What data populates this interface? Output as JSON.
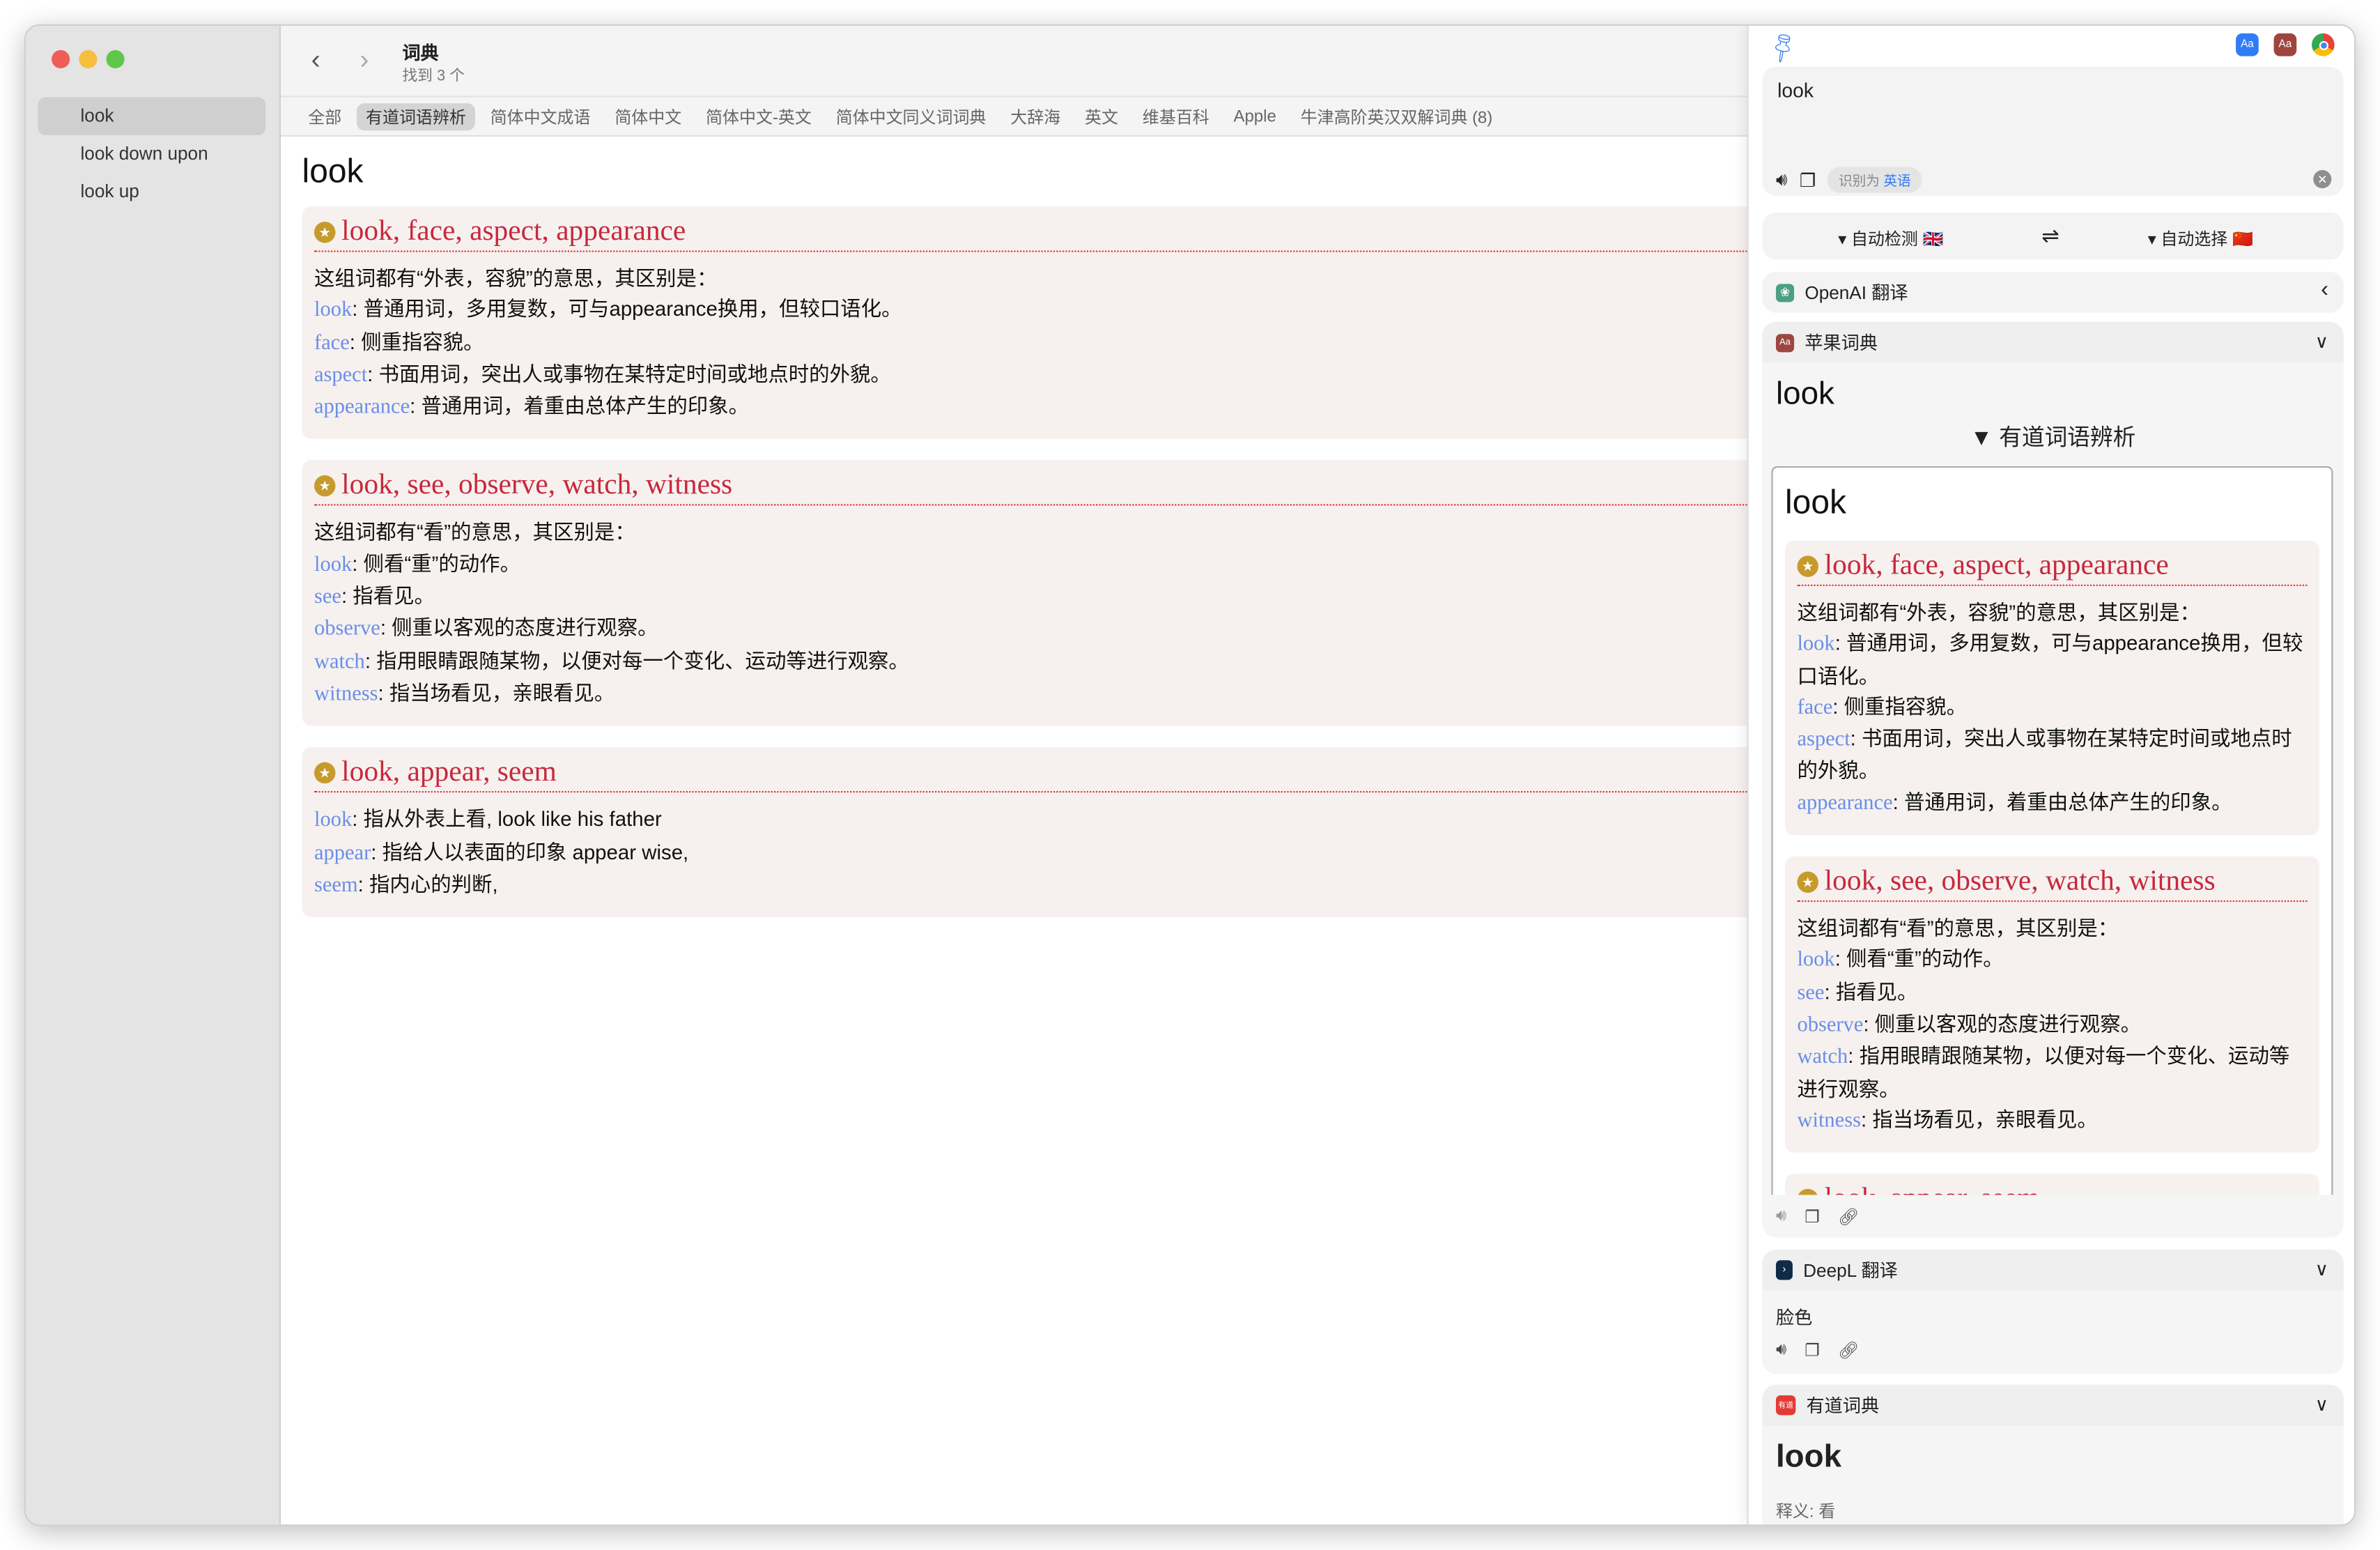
{
  "sidebar": {
    "items": [
      {
        "label": "look",
        "selected": true
      },
      {
        "label": "look down upon"
      },
      {
        "label": "look up"
      }
    ]
  },
  "toolbar": {
    "back_icon": "chevron-left-icon",
    "forward_icon": "chevron-right-icon",
    "title": "词典",
    "subtitle": "找到 3 个"
  },
  "tabs": [
    {
      "label": "全部"
    },
    {
      "label": "有道词语辨析",
      "selected": true
    },
    {
      "label": "简体中文成语"
    },
    {
      "label": "简体中文"
    },
    {
      "label": "简体中文-英文"
    },
    {
      "label": "简体中文同义词词典"
    },
    {
      "label": "大辞海"
    },
    {
      "label": "英文"
    },
    {
      "label": "维基百科"
    },
    {
      "label": "Apple"
    },
    {
      "label": "牛津高阶英汉双解词典 (8)"
    }
  ],
  "main": {
    "headword": "look",
    "entries": [
      {
        "title": "look, face, aspect, appearance",
        "intro": "这组词都有“外表，容貌”的意思，其区别是：",
        "lines": [
          {
            "word": "look",
            "def": ": 普通用词，多用复数，可与appearance换用，但较口语化。"
          },
          {
            "word": "face",
            "def": ": 侧重指容貌。"
          },
          {
            "word": "aspect",
            "def": ": 书面用词，突出人或事物在某特定时间或地点时的外貌。"
          },
          {
            "word": "appearance",
            "def": ": 普通用词，着重由总体产生的印象。"
          }
        ]
      },
      {
        "title": "look, see, observe, watch, witness",
        "intro": "这组词都有“看”的意思，其区别是：",
        "lines": [
          {
            "word": "look",
            "def": ": 侧看“重”的动作。"
          },
          {
            "word": "see",
            "def": ": 指看见。"
          },
          {
            "word": "observe",
            "def": ": 侧重以客观的态度进行观察。"
          },
          {
            "word": "watch",
            "def": ": 指用眼睛跟随某物，以便对每一个变化、运动等进行观察。"
          },
          {
            "word": "witness",
            "def": ": 指当场看见，亲眼看见。"
          }
        ]
      },
      {
        "title": "look, appear, seem",
        "intro": "",
        "lines": [
          {
            "word": "look",
            "def": ": 指从外表上看, look like his father"
          },
          {
            "word": "appear",
            "def": ": 指给人以表面的印象 appear wise,"
          },
          {
            "word": "seem",
            "def": ": 指内心的判断,"
          }
        ]
      }
    ]
  },
  "panel": {
    "input": {
      "value": "look",
      "detected_prefix": "识别为",
      "detected_lang": "英语"
    },
    "lang": {
      "source": "自动检测",
      "source_flag": "🇬🇧",
      "target": "自动选择",
      "target_flag": "🇨🇳",
      "swap_icon": "swap-icon"
    },
    "openai": {
      "label": "OpenAI 翻译"
    },
    "apple": {
      "label": "苹果词典",
      "headword": "look",
      "section": "▼ 有道词语辨析",
      "inner_headword": "look"
    },
    "deepl": {
      "label": "DeepL 翻译",
      "result": "脸色"
    },
    "youdao": {
      "label": "有道词典",
      "headword": "look",
      "meaning": "释义: 看"
    },
    "colors": {
      "accent": "#2f7cf6",
      "title_red": "#c8283c",
      "word_blue": "#6a8ee8"
    }
  }
}
